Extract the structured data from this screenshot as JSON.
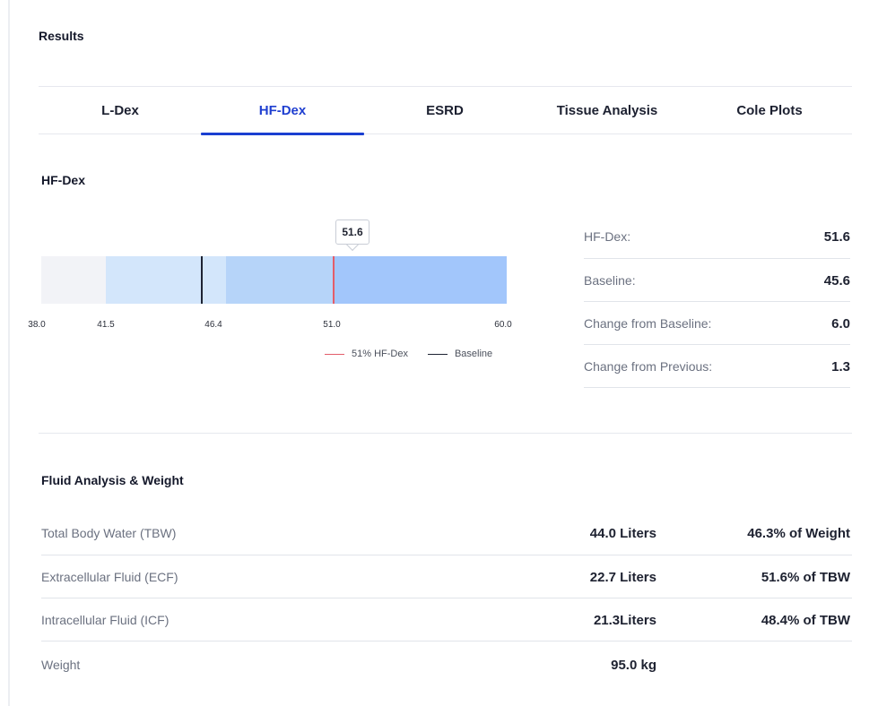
{
  "results_title": "Results",
  "tabs": [
    {
      "label": "L-Dex",
      "active": false
    },
    {
      "label": "HF-Dex",
      "active": true
    },
    {
      "label": "ESRD",
      "active": false
    },
    {
      "label": "Tissue Analysis",
      "active": false
    },
    {
      "label": "Cole Plots",
      "active": false
    }
  ],
  "hfdex": {
    "title": "HF-Dex",
    "tooltip_value": "51.6",
    "ticks": [
      "38.0",
      "41.5",
      "46.4",
      "51.0",
      "60.0"
    ],
    "legend": {
      "current_label": "51% HF-Dex",
      "baseline_label": "Baseline"
    },
    "colors": {
      "band_1": "#f2f3f7",
      "band_2": "#d3e6fb",
      "band_3": "#b6d4f9",
      "band_4": "#a2c6fb",
      "current_marker": "#e35d6a",
      "baseline_marker": "#1d2333"
    }
  },
  "stats": [
    {
      "label": "HF-Dex:",
      "value": "51.6"
    },
    {
      "label": "Baseline:",
      "value": "45.6"
    },
    {
      "label": "Change from Baseline:",
      "value": "6.0"
    },
    {
      "label": "Change from Previous:",
      "value": "1.3"
    }
  ],
  "fluid": {
    "title": "Fluid Analysis & Weight",
    "rows": [
      {
        "label": "Total Body Water (TBW)",
        "amount": "44.0 Liters",
        "percent": "46.3% of Weight"
      },
      {
        "label": "Extracellular Fluid (ECF)",
        "amount": "22.7 Liters",
        "percent": "51.6% of TBW"
      },
      {
        "label": "Intracellular Fluid (ICF)",
        "amount": "21.3Liters",
        "percent": "48.4% of TBW"
      },
      {
        "label": "Weight",
        "amount": "95.0 kg",
        "percent": ""
      }
    ]
  },
  "accent_color": "#1f3fd0"
}
